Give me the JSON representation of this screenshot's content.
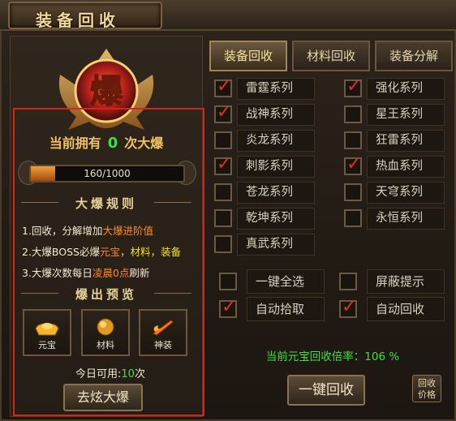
{
  "window": {
    "title": "装备回收"
  },
  "left": {
    "emblem_char": "爆",
    "have_prefix": "当前拥有",
    "have_count": "0",
    "have_suffix": "次大爆",
    "progress_text": "160/1000",
    "progress_fraction": 0.16,
    "rules_title": "大爆规则",
    "rules": [
      {
        "a": "1.回收，分解增加",
        "b": "大爆进阶值",
        "c": "",
        "d": ""
      },
      {
        "a": "2.大爆BOSS必爆",
        "b": "元宝",
        "c": "，材料，",
        "d": "装备"
      },
      {
        "a": "3.大爆次数每日",
        "b": "凌晨0点",
        "c": "刷新",
        "d": ""
      }
    ],
    "preview_title": "爆出预览",
    "drops": [
      {
        "label": "元宝",
        "icon": "gold-ingot-icon"
      },
      {
        "label": "材料",
        "icon": "material-orb-icon"
      },
      {
        "label": "神装",
        "icon": "flaming-sword-icon"
      }
    ],
    "today_prefix": "今日可用:",
    "today_count": "10",
    "today_suffix": "次",
    "burst_button": "去炫大爆"
  },
  "tabs": [
    "装备回收",
    "材料回收",
    "装备分解"
  ],
  "series": [
    {
      "label": "雷霆系列",
      "checked": true
    },
    {
      "label": "强化系列",
      "checked": true
    },
    {
      "label": "战神系列",
      "checked": true
    },
    {
      "label": "星王系列",
      "checked": false
    },
    {
      "label": "炎龙系列",
      "checked": false
    },
    {
      "label": "狂雷系列",
      "checked": false
    },
    {
      "label": "刺影系列",
      "checked": true
    },
    {
      "label": "热血系列",
      "checked": true
    },
    {
      "label": "苍龙系列",
      "checked": false
    },
    {
      "label": "天穹系列",
      "checked": false
    },
    {
      "label": "乾坤系列",
      "checked": false
    },
    {
      "label": "永恒系列",
      "checked": false
    },
    {
      "label": "真武系列",
      "checked": false
    }
  ],
  "options": [
    {
      "label": "一键全选",
      "checked": false
    },
    {
      "label": "屏蔽提示",
      "checked": false
    },
    {
      "label": "自动拾取",
      "checked": true
    },
    {
      "label": "自动回收",
      "checked": true
    }
  ],
  "rate_text": "当前元宝回收倍率：106 %",
  "onekey_button": "一键回收",
  "price_button": [
    "回收",
    "价格"
  ],
  "colors": {
    "highlight_orange": "#ff8a1e",
    "highlight_yellow": "#f5e020",
    "green": "#3ee23a",
    "red_frame": "#d8221c"
  }
}
